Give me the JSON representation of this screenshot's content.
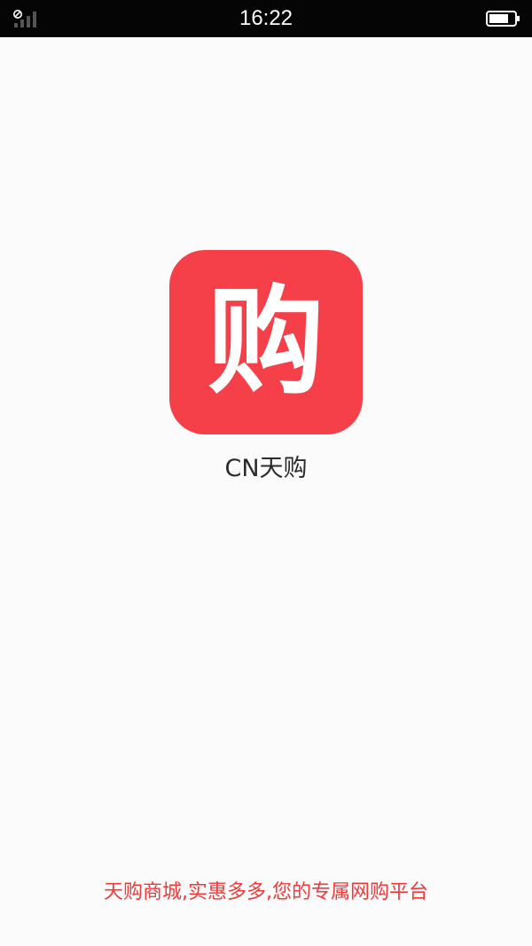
{
  "status_bar": {
    "time": "16:22",
    "signal_icon": "signal-icon",
    "battery_icon": "battery-icon"
  },
  "splash": {
    "icon": {
      "glyph": "购",
      "background_color": "#f5404a"
    },
    "app_name": "CN天购",
    "slogan": "天购商城,实惠多多,您的专属网购平台",
    "slogan_color": "#f03a3a"
  }
}
